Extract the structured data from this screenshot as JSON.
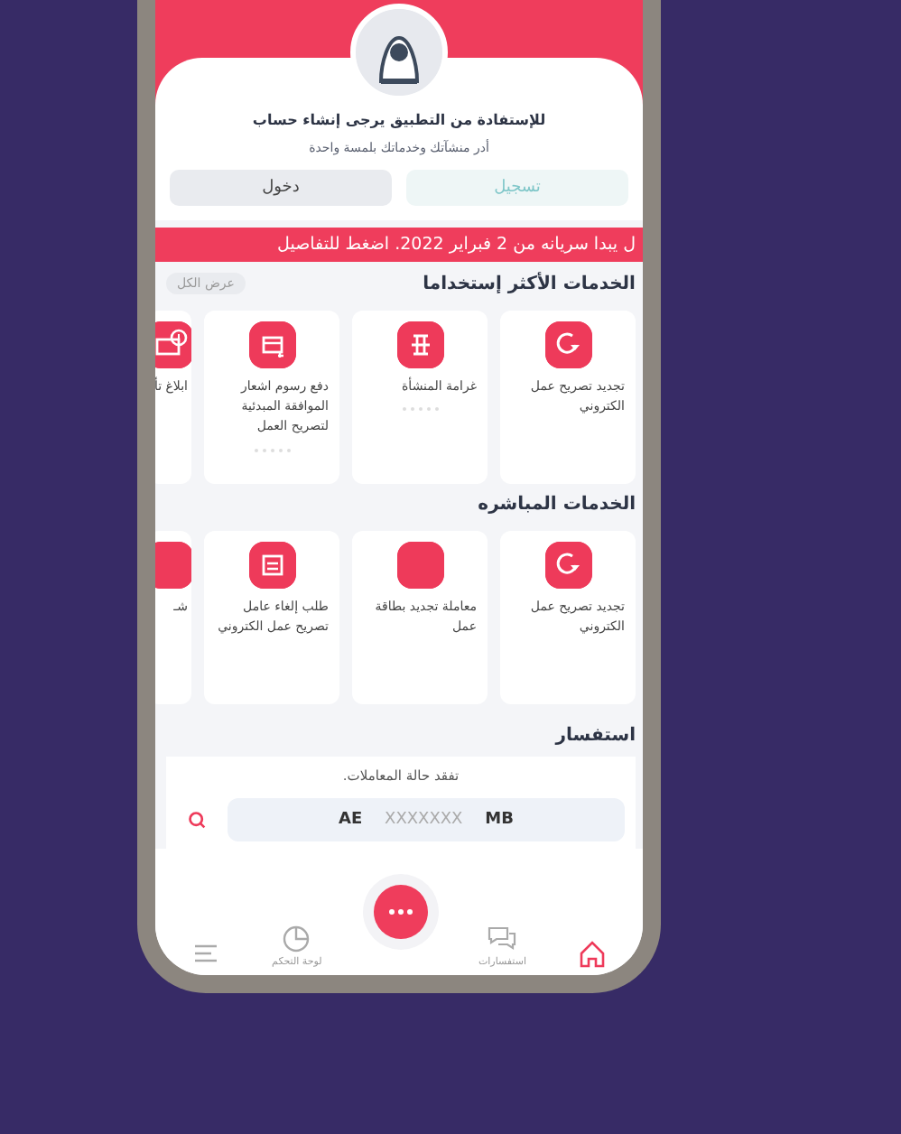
{
  "header": {
    "title": "للإستفادة من التطبيق يرجى إنشاء حساب",
    "subtitle": "أدر منشآتك وخدماتك بلمسة واحدة",
    "buttons": [
      {
        "label": "تسجيل",
        "kind": "register"
      },
      {
        "label": "دخول",
        "kind": "login"
      }
    ]
  },
  "banner": "ل يبدا سريانه من 2 فبراير 2022. اضغط للتفاصيل",
  "sections": [
    {
      "title": "الخدمات الأكثر إستخداما",
      "action": "عرض الكل",
      "cards": [
        {
          "label": "تجديد تصريح عمل الكتروني",
          "kind": "full",
          "dots": false
        },
        {
          "label": "غرامة المنشأة",
          "kind": "full",
          "dots": true
        },
        {
          "label": "دفع رسوم اشعار الموافقة المبدئية لتصريح العمل",
          "kind": "full",
          "dots": true
        },
        {
          "label": "ابلاغ تأ",
          "kind": "partial",
          "dots": false
        }
      ]
    },
    {
      "title": "الخدمات المباشره",
      "cards": [
        {
          "label": "تجديد تصريح عمل الكتروني",
          "kind": "full",
          "dots": false
        },
        {
          "label": "معاملة تجديد بطاقة عمل",
          "kind": "full",
          "dots": false
        },
        {
          "label": "طلب إلغاء عامل تصريح عمل الكتروني",
          "kind": "full",
          "dots": false
        },
        {
          "label": "شـ",
          "kind": "partial",
          "dots": false
        }
      ]
    }
  ],
  "inquiry": {
    "title": "استفسار",
    "caption": "تفقد حالة المعاملات.",
    "prefix": "AE",
    "placeholder": "XXXXXXX",
    "suffix": "MB"
  },
  "nav": [
    {
      "selected": true
    },
    {
      "label": "استفسارات",
      "selected": false
    },
    {
      "label": "لوحة التحكم",
      "selected": false
    },
    {
      "selected": false
    }
  ]
}
